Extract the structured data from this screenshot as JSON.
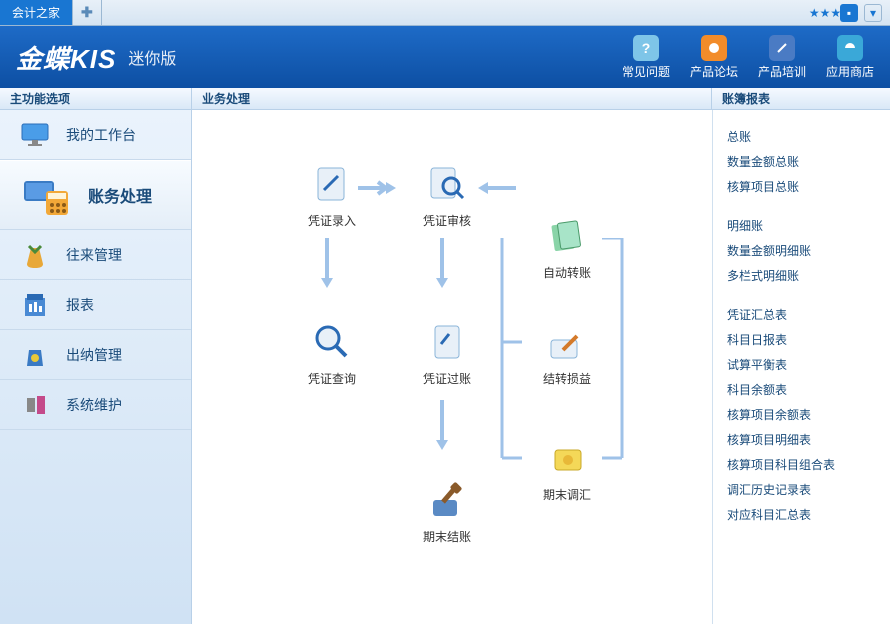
{
  "tabs": {
    "active": "会计之家"
  },
  "header": {
    "logo": "金蝶KIS",
    "sub": "迷你版",
    "links": [
      {
        "label": "常见问题"
      },
      {
        "label": "产品论坛"
      },
      {
        "label": "产品培训"
      },
      {
        "label": "应用商店"
      }
    ]
  },
  "section_titles": {
    "left": "主功能选项",
    "mid": "业务处理",
    "right": "账簿报表"
  },
  "sidebar": {
    "items": [
      {
        "label": "我的工作台"
      },
      {
        "label": "账务处理"
      },
      {
        "label": "往来管理"
      },
      {
        "label": "报表"
      },
      {
        "label": "出纳管理"
      },
      {
        "label": "系统维护"
      }
    ]
  },
  "flow": {
    "nodes": {
      "voucher_entry": {
        "label": "凭证录入"
      },
      "voucher_audit": {
        "label": "凭证审核"
      },
      "auto_transfer": {
        "label": "自动转账"
      },
      "voucher_query": {
        "label": "凭证查询"
      },
      "voucher_post": {
        "label": "凭证过账"
      },
      "carry_pl": {
        "label": "结转损益"
      },
      "period_adjust": {
        "label": "期末调汇"
      },
      "period_close": {
        "label": "期末结账"
      }
    }
  },
  "reports": {
    "g1": [
      "总账",
      "数量金额总账",
      "核算项目总账"
    ],
    "g2": [
      "明细账",
      "数量金额明细账",
      "多栏式明细账"
    ],
    "g3": [
      "凭证汇总表",
      "科目日报表",
      "试算平衡表",
      "科目余额表",
      "核算项目余额表",
      "核算项目明细表",
      "核算项目科目组合表",
      "调汇历史记录表",
      "对应科目汇总表"
    ]
  }
}
